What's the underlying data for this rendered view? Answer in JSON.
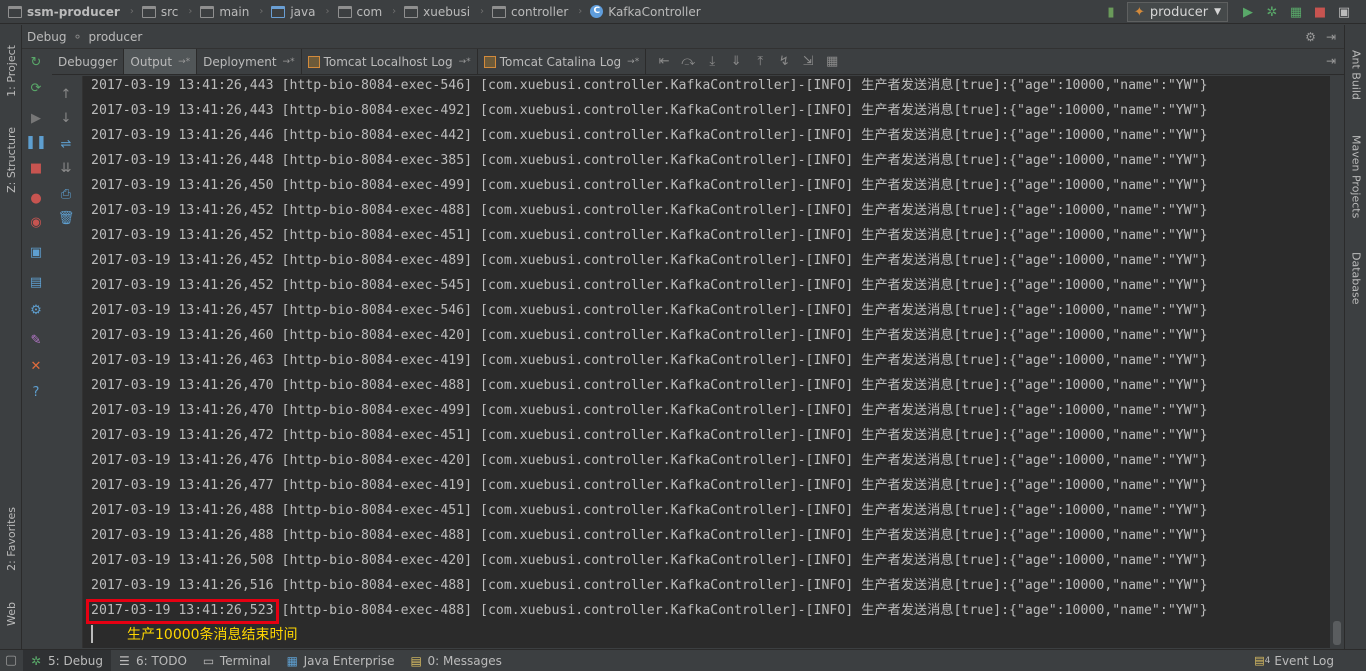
{
  "breadcrumbs": [
    {
      "label": "ssm-producer",
      "icon": "project-folder-icon"
    },
    {
      "label": "src",
      "icon": "folder-icon"
    },
    {
      "label": "main",
      "icon": "folder-icon"
    },
    {
      "label": "java",
      "icon": "source-folder-icon"
    },
    {
      "label": "com",
      "icon": "package-icon"
    },
    {
      "label": "xuebusi",
      "icon": "package-icon"
    },
    {
      "label": "controller",
      "icon": "package-icon"
    },
    {
      "label": "KafkaController",
      "icon": "class-icon"
    }
  ],
  "run_config": {
    "label": "producer"
  },
  "debug_panel": {
    "title": "Debug",
    "config": "producer"
  },
  "tabs": [
    {
      "label": "Debugger",
      "active": false
    },
    {
      "label": "Output",
      "active": true
    },
    {
      "label": "Deployment",
      "active": false
    },
    {
      "label": "Tomcat Localhost Log",
      "active": false
    },
    {
      "label": "Tomcat Catalina Log",
      "active": false
    }
  ],
  "left_tool_windows": [
    {
      "label": "1: Project"
    },
    {
      "label": "Z: Structure"
    },
    {
      "label": "2: Favorites"
    },
    {
      "label": "Web"
    }
  ],
  "right_tool_windows": [
    {
      "label": "Ant Build"
    },
    {
      "label": "Maven Projects"
    },
    {
      "label": "Database"
    }
  ],
  "console": {
    "lines": [
      "2017-03-19 13:41:26,443 [http-bio-8084-exec-546] [com.xuebusi.controller.KafkaController]-[INFO] 生产者发送消息[true]:{\"age\":10000,\"name\":\"YW\"}",
      "2017-03-19 13:41:26,443 [http-bio-8084-exec-492] [com.xuebusi.controller.KafkaController]-[INFO] 生产者发送消息[true]:{\"age\":10000,\"name\":\"YW\"}",
      "2017-03-19 13:41:26,446 [http-bio-8084-exec-442] [com.xuebusi.controller.KafkaController]-[INFO] 生产者发送消息[true]:{\"age\":10000,\"name\":\"YW\"}",
      "2017-03-19 13:41:26,448 [http-bio-8084-exec-385] [com.xuebusi.controller.KafkaController]-[INFO] 生产者发送消息[true]:{\"age\":10000,\"name\":\"YW\"}",
      "2017-03-19 13:41:26,450 [http-bio-8084-exec-499] [com.xuebusi.controller.KafkaController]-[INFO] 生产者发送消息[true]:{\"age\":10000,\"name\":\"YW\"}",
      "2017-03-19 13:41:26,452 [http-bio-8084-exec-488] [com.xuebusi.controller.KafkaController]-[INFO] 生产者发送消息[true]:{\"age\":10000,\"name\":\"YW\"}",
      "2017-03-19 13:41:26,452 [http-bio-8084-exec-451] [com.xuebusi.controller.KafkaController]-[INFO] 生产者发送消息[true]:{\"age\":10000,\"name\":\"YW\"}",
      "2017-03-19 13:41:26,452 [http-bio-8084-exec-489] [com.xuebusi.controller.KafkaController]-[INFO] 生产者发送消息[true]:{\"age\":10000,\"name\":\"YW\"}",
      "2017-03-19 13:41:26,452 [http-bio-8084-exec-545] [com.xuebusi.controller.KafkaController]-[INFO] 生产者发送消息[true]:{\"age\":10000,\"name\":\"YW\"}",
      "2017-03-19 13:41:26,457 [http-bio-8084-exec-546] [com.xuebusi.controller.KafkaController]-[INFO] 生产者发送消息[true]:{\"age\":10000,\"name\":\"YW\"}",
      "2017-03-19 13:41:26,460 [http-bio-8084-exec-420] [com.xuebusi.controller.KafkaController]-[INFO] 生产者发送消息[true]:{\"age\":10000,\"name\":\"YW\"}",
      "2017-03-19 13:41:26,463 [http-bio-8084-exec-419] [com.xuebusi.controller.KafkaController]-[INFO] 生产者发送消息[true]:{\"age\":10000,\"name\":\"YW\"}",
      "2017-03-19 13:41:26,470 [http-bio-8084-exec-488] [com.xuebusi.controller.KafkaController]-[INFO] 生产者发送消息[true]:{\"age\":10000,\"name\":\"YW\"}",
      "2017-03-19 13:41:26,470 [http-bio-8084-exec-499] [com.xuebusi.controller.KafkaController]-[INFO] 生产者发送消息[true]:{\"age\":10000,\"name\":\"YW\"}",
      "2017-03-19 13:41:26,472 [http-bio-8084-exec-451] [com.xuebusi.controller.KafkaController]-[INFO] 生产者发送消息[true]:{\"age\":10000,\"name\":\"YW\"}",
      "2017-03-19 13:41:26,476 [http-bio-8084-exec-420] [com.xuebusi.controller.KafkaController]-[INFO] 生产者发送消息[true]:{\"age\":10000,\"name\":\"YW\"}",
      "2017-03-19 13:41:26,477 [http-bio-8084-exec-419] [com.xuebusi.controller.KafkaController]-[INFO] 生产者发送消息[true]:{\"age\":10000,\"name\":\"YW\"}",
      "2017-03-19 13:41:26,488 [http-bio-8084-exec-451] [com.xuebusi.controller.KafkaController]-[INFO] 生产者发送消息[true]:{\"age\":10000,\"name\":\"YW\"}",
      "2017-03-19 13:41:26,488 [http-bio-8084-exec-488] [com.xuebusi.controller.KafkaController]-[INFO] 生产者发送消息[true]:{\"age\":10000,\"name\":\"YW\"}",
      "2017-03-19 13:41:26,508 [http-bio-8084-exec-420] [com.xuebusi.controller.KafkaController]-[INFO] 生产者发送消息[true]:{\"age\":10000,\"name\":\"YW\"}",
      "2017-03-19 13:41:26,516 [http-bio-8084-exec-488] [com.xuebusi.controller.KafkaController]-[INFO] 生产者发送消息[true]:{\"age\":10000,\"name\":\"YW\"}",
      "2017-03-19 13:41:26,523 [http-bio-8084-exec-488] [com.xuebusi.controller.KafkaController]-[INFO] 生产者发送消息[true]:{\"age\":10000,\"name\":\"YW\"}"
    ],
    "annotation": "生产10000条消息结束时间",
    "highlight_color": "#e60012",
    "annotation_color": "#ffd700"
  },
  "status_bar": [
    {
      "label": "5: Debug",
      "active": true,
      "icon": "bug-icon"
    },
    {
      "label": "6: TODO",
      "active": false,
      "icon": "todo-icon"
    },
    {
      "label": "Terminal",
      "active": false,
      "icon": "terminal-icon"
    },
    {
      "label": "Java Enterprise",
      "active": false,
      "icon": "java-enterprise-icon"
    },
    {
      "label": "0: Messages",
      "active": false,
      "icon": "messages-icon"
    }
  ],
  "event_log": {
    "label": "Event Log",
    "count": "4"
  }
}
